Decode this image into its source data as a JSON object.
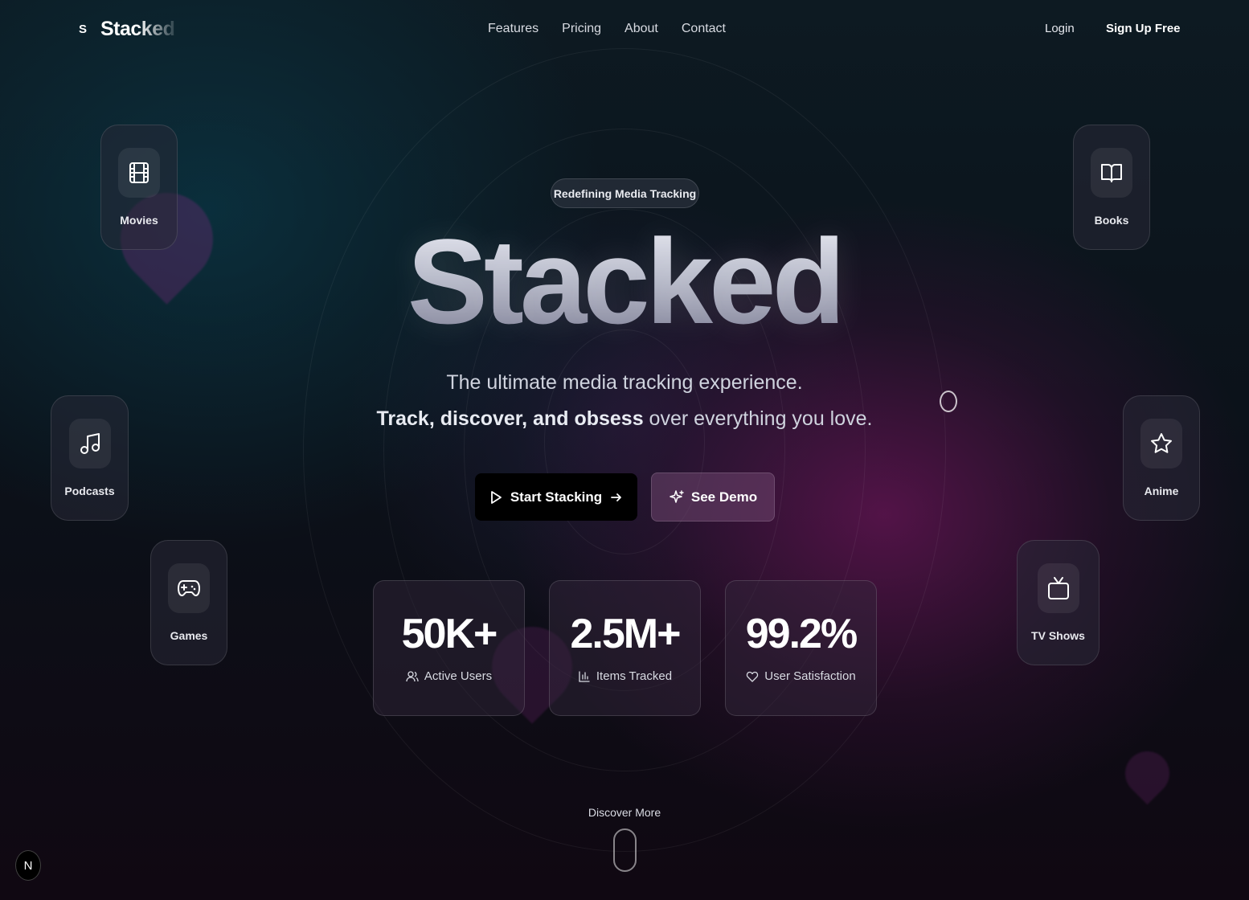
{
  "nav": {
    "logo_mark": "S",
    "logo_text": "Stacked",
    "links": [
      "Features",
      "Pricing",
      "About",
      "Contact"
    ],
    "login": "Login",
    "signup": "Sign Up Free"
  },
  "hero": {
    "badge": "Redefining Media Tracking",
    "title": "Stacked",
    "subtitle_line1": "The ultimate media tracking experience.",
    "subtitle_bold": "Track, discover, and obsess",
    "subtitle_rest": " over everything you love.",
    "primary_button": "Start Stacking",
    "secondary_button": "See Demo"
  },
  "stats": [
    {
      "value": "50K+",
      "label": "Active Users",
      "icon": "users-icon"
    },
    {
      "value": "2.5M+",
      "label": "Items Tracked",
      "icon": "bar-chart-icon"
    },
    {
      "value": "99.2%",
      "label": "User Satisfaction",
      "icon": "heart-icon"
    }
  ],
  "media": {
    "movies": "Movies",
    "books": "Books",
    "podcasts": "Podcasts",
    "anime": "Anime",
    "games": "Games",
    "tv_shows": "TV Shows"
  },
  "footer": {
    "discover": "Discover More",
    "dev_badge": "N"
  },
  "colors": {
    "primary_button_bg": "#000000",
    "secondary_button_bg": "#6e466e",
    "accent_magenta": "#5f1450",
    "accent_teal": "#0a3746"
  }
}
